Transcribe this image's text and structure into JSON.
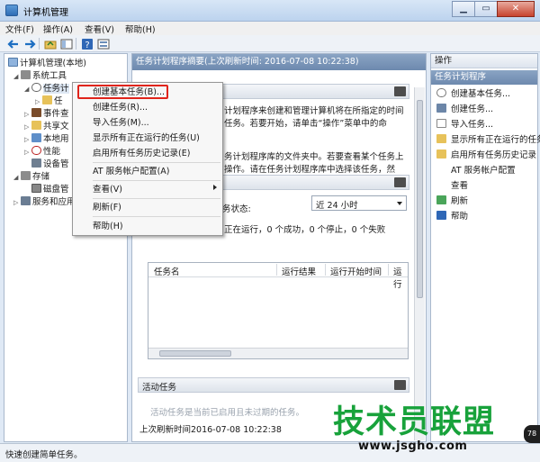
{
  "window": {
    "title": "计算机管理",
    "buttons": [
      "▁",
      "▭",
      "✕"
    ]
  },
  "menubar": [
    "文件(F)",
    "操作(A)",
    "查看(V)",
    "帮助(H)"
  ],
  "toolbar_icons": [
    "back-arrow-icon",
    "forward-arrow-icon",
    "up-folder-icon",
    "show-hide-tree-icon",
    "help-icon",
    "properties-icon"
  ],
  "tree": {
    "root": "计算机管理(本地)",
    "items": [
      "系统工具",
      "任务计",
      "任",
      "事件查",
      "共享文",
      "本地用",
      "性能",
      "设备管",
      "存储",
      "磁盘管",
      "服务和应用"
    ]
  },
  "center": {
    "header": "任务计划程序摘要(上次刷新时间: 2016-07-08 10:22:38)",
    "overview_lines": [
      "计划程序来创建和管理计算机将在所指定的时间",
      "任务。若要开始，请单击“操作”菜单中的命"
    ],
    "overview_lines2": [
      "务计划程序库的文件夹中。若要查看某个任务上",
      "操作。请在任务计划程序库中选择该任务，然"
    ],
    "status_label": "务状态:",
    "status_value": "近 24 小时",
    "status_summary": "正在运行，0 个成功，0 个停止，0 个失败",
    "grid_columns": [
      "任务名",
      "运行结果",
      "运行开始时间",
      "运行"
    ],
    "active_tasks": "活动任务",
    "active_line": "活动任务是当前已启用且未过期的任务。",
    "last_refresh": "上次刷新时间2016-07-08 10:22:38"
  },
  "actions": {
    "title": "操作",
    "section": "任务计划程序",
    "items": [
      "创建基本任务...",
      "创建任务...",
      "导入任务...",
      "显示所有正在运行的任务",
      "启用所有任务历史记录",
      "AT 服务帐户配置",
      "查看",
      "刷新",
      "帮助"
    ]
  },
  "context_menu": {
    "items": [
      "创建基本任务(B)...",
      "创建任务(R)...",
      "导入任务(M)...",
      "显示所有正在运行的任务(U)",
      "启用所有任务历史记录(E)",
      "AT 服务帐户配置(A)",
      "查看(V)",
      "刷新(F)",
      "帮助(H)"
    ]
  },
  "status_bar": "快速创建简单任务。",
  "watermark": {
    "brand": "技术员联盟",
    "url": "www.jsgho.com",
    "badge": "78"
  },
  "colors": {
    "pane_header": "#6d89ae",
    "highlight": "#e0241b",
    "watermark_green": "#18a23b"
  }
}
